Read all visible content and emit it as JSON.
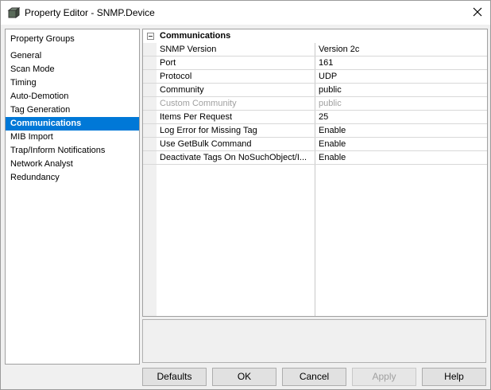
{
  "window": {
    "title": "Property Editor - SNMP.Device"
  },
  "left": {
    "header": "Property Groups",
    "items": [
      {
        "label": "General"
      },
      {
        "label": "Scan Mode"
      },
      {
        "label": "Timing"
      },
      {
        "label": "Auto-Demotion"
      },
      {
        "label": "Tag Generation"
      },
      {
        "label": "Communications",
        "selected": true
      },
      {
        "label": "MIB Import"
      },
      {
        "label": "Trap/Inform Notifications"
      },
      {
        "label": "Network Analyst"
      },
      {
        "label": "Redundancy"
      }
    ]
  },
  "grid": {
    "section": "Communications",
    "rows": [
      {
        "name": "SNMP Version",
        "value": "Version 2c"
      },
      {
        "name": "Port",
        "value": "161"
      },
      {
        "name": "Protocol",
        "value": "UDP"
      },
      {
        "name": "Community",
        "value": "public"
      },
      {
        "name": "Custom Community",
        "value": "public",
        "disabled": true
      },
      {
        "name": "Items Per Request",
        "value": "25"
      },
      {
        "name": "Log Error for Missing Tag",
        "value": "Enable"
      },
      {
        "name": "Use GetBulk Command",
        "value": "Enable"
      },
      {
        "name": "Deactivate Tags On NoSuchObject/I...",
        "value": "Enable"
      }
    ]
  },
  "buttons": {
    "defaults": "Defaults",
    "ok": "OK",
    "cancel": "Cancel",
    "apply": "Apply",
    "help": "Help"
  },
  "colors": {
    "selection": "#0078d7",
    "disabled_text": "#a0a0a0"
  },
  "icons": {
    "app": "property-editor-icon",
    "close": "close-icon",
    "collapse": "minus-box-icon"
  }
}
